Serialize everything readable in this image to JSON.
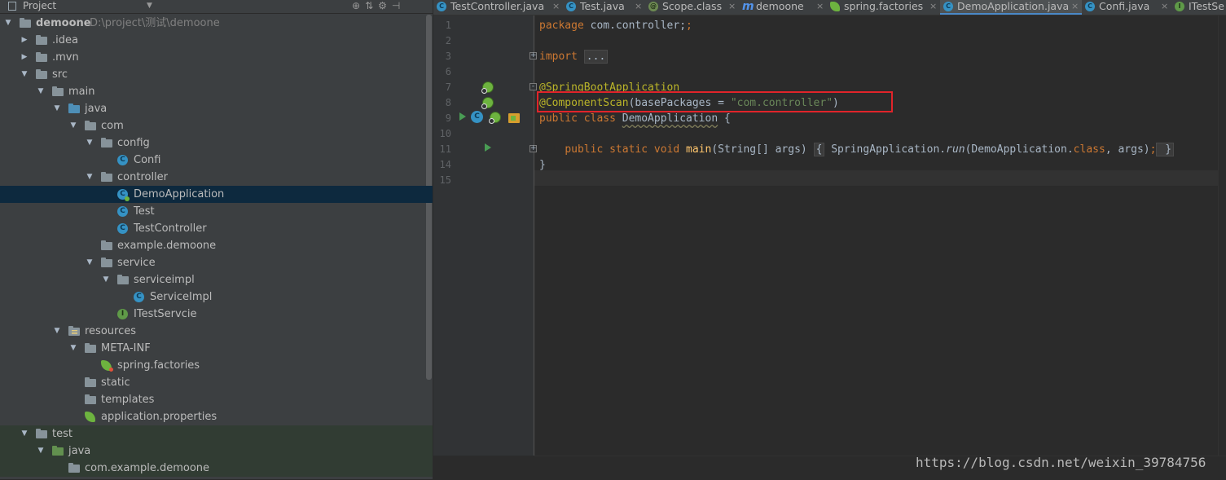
{
  "project_panel": {
    "title": "Project",
    "tree": [
      {
        "depth": 0,
        "arrow": "▼",
        "icon": "module",
        "label": "demoone",
        "path": "D:\\project\\测试\\demoone",
        "bold": true
      },
      {
        "depth": 1,
        "arrow": "▶",
        "icon": "folder",
        "label": ".idea"
      },
      {
        "depth": 1,
        "arrow": "▶",
        "icon": "folder",
        "label": ".mvn"
      },
      {
        "depth": 1,
        "arrow": "▼",
        "icon": "folder",
        "label": "src"
      },
      {
        "depth": 2,
        "arrow": "▼",
        "icon": "folder",
        "label": "main"
      },
      {
        "depth": 3,
        "arrow": "▼",
        "icon": "folder-src",
        "label": "java"
      },
      {
        "depth": 4,
        "arrow": "▼",
        "icon": "package",
        "label": "com"
      },
      {
        "depth": 5,
        "arrow": "▼",
        "icon": "package",
        "label": "config"
      },
      {
        "depth": 6,
        "arrow": "",
        "icon": "class",
        "label": "Confi"
      },
      {
        "depth": 5,
        "arrow": "▼",
        "icon": "package",
        "label": "controller"
      },
      {
        "depth": 6,
        "arrow": "",
        "icon": "spring-class",
        "label": "DemoApplication",
        "selected": true
      },
      {
        "depth": 6,
        "arrow": "",
        "icon": "class",
        "label": "Test"
      },
      {
        "depth": 6,
        "arrow": "",
        "icon": "class",
        "label": "TestController"
      },
      {
        "depth": 5,
        "arrow": "",
        "icon": "package",
        "label": "example.demoone"
      },
      {
        "depth": 5,
        "arrow": "▼",
        "icon": "package",
        "label": "service"
      },
      {
        "depth": 6,
        "arrow": "▼",
        "icon": "package",
        "label": "serviceimpl"
      },
      {
        "depth": 7,
        "arrow": "",
        "icon": "class",
        "label": "ServiceImpl"
      },
      {
        "depth": 6,
        "arrow": "",
        "icon": "interface",
        "label": "ITestServcie"
      },
      {
        "depth": 3,
        "arrow": "▼",
        "icon": "folder-res",
        "label": "resources"
      },
      {
        "depth": 4,
        "arrow": "▼",
        "icon": "folder",
        "label": "META-INF"
      },
      {
        "depth": 5,
        "arrow": "",
        "icon": "spring-factories",
        "label": "spring.factories"
      },
      {
        "depth": 4,
        "arrow": "",
        "icon": "folder",
        "label": "static"
      },
      {
        "depth": 4,
        "arrow": "",
        "icon": "folder",
        "label": "templates"
      },
      {
        "depth": 4,
        "arrow": "",
        "icon": "spring-properties",
        "label": "application.properties"
      },
      {
        "depth": 1,
        "arrow": "▼",
        "icon": "folder",
        "label": "test",
        "test_hl": true
      },
      {
        "depth": 2,
        "arrow": "▼",
        "icon": "folder-test",
        "label": "java"
      },
      {
        "depth": 3,
        "arrow": "",
        "icon": "package",
        "label": "com.example.demoone"
      }
    ]
  },
  "tabs": [
    {
      "label": "TestController.java",
      "icon": "c",
      "active": false
    },
    {
      "label": "Test.java",
      "icon": "c",
      "active": false
    },
    {
      "label": "Scope.class",
      "icon": "a",
      "active": false
    },
    {
      "label": "demoone",
      "icon": "m",
      "active": false
    },
    {
      "label": "spring.factories",
      "icon": "leaf",
      "active": false
    },
    {
      "label": "DemoApplication.java",
      "icon": "c",
      "active": true
    },
    {
      "label": "Confi.java",
      "icon": "c",
      "active": false
    },
    {
      "label": "ITestSe",
      "icon": "i",
      "active": false
    }
  ],
  "editor": {
    "line_numbers": [
      "1",
      "2",
      "3",
      "6",
      "7",
      "8",
      "9",
      "10",
      "11",
      "14",
      "15"
    ],
    "code": {
      "l1_kw": "package",
      "l1_rest": " com.controller;",
      "l3_kw": "import",
      "l3_fold": "...",
      "l7_ann": "@SpringBootApplication",
      "l8_ann": "@ComponentScan",
      "l8_a": "(basePackages = ",
      "l8_str": "\"com.controller\"",
      "l8_b": ")",
      "l9_kw": "public class ",
      "l9_cls": "DemoApplication",
      "l9_rest": " {",
      "l11_kw": "public static void ",
      "l11_meth": "main",
      "l11_a": "(String[] args) ",
      "l11_fold_open": "{",
      "l11_b": " SpringApplication.",
      "l11_run": "run",
      "l11_c": "(DemoApplication.",
      "l11_kw2": "class",
      "l11_d": ", args)",
      "l11_semi": ";",
      "l11_fold_close": " }",
      "l14": "}"
    }
  },
  "watermark": "https://blog.csdn.net/weixin_39784756",
  "colors": {
    "keyword": "#cc7832",
    "annotation": "#bbb529",
    "string": "#6a8759",
    "method": "#ffc66d",
    "highlight_box": "#e0242a",
    "selection": "#0d293e"
  }
}
